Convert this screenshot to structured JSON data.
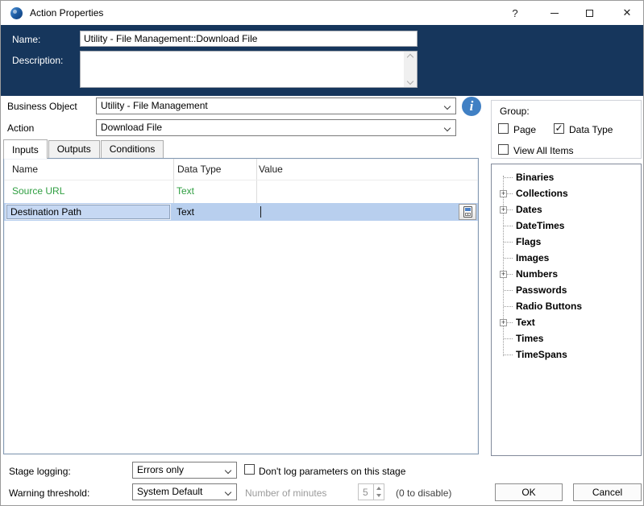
{
  "window": {
    "title": "Action Properties",
    "help_glyph": "?"
  },
  "colors": {
    "header_navy": "#16365c",
    "input_green": "#2f9e41",
    "selection_blue": "#b8cfee",
    "info_blue": "#4080c4"
  },
  "header": {
    "name_label": "Name:",
    "name_value": "Utility - File Management::Download File",
    "description_label": "Description:",
    "description_value": ""
  },
  "form": {
    "business_object_label": "Business Object",
    "business_object_value": "Utility - File Management",
    "action_label": "Action",
    "action_value": "Download File"
  },
  "tabs": [
    {
      "label": "Inputs",
      "active": true
    },
    {
      "label": "Outputs",
      "active": false
    },
    {
      "label": "Conditions",
      "active": false
    }
  ],
  "table": {
    "columns": [
      "Name",
      "Data Type",
      "Value"
    ],
    "rows": [
      {
        "name": "Source URL",
        "data_type": "Text",
        "value": "",
        "state": "input-green"
      },
      {
        "name": "Destination Path",
        "data_type": "Text",
        "value": "",
        "state": "selected-editing"
      }
    ]
  },
  "group_panel": {
    "title": "Group:",
    "checkboxes": [
      {
        "label": "Page",
        "checked": false,
        "glyph": ""
      },
      {
        "label": "Data Type",
        "checked": true,
        "glyph": "✓"
      },
      {
        "label": "View All Items",
        "checked": false,
        "glyph": ""
      }
    ]
  },
  "tree": {
    "items": [
      {
        "label": "Binaries",
        "expandable": false
      },
      {
        "label": "Collections",
        "expandable": true,
        "expander_glyph": "+"
      },
      {
        "label": "Dates",
        "expandable": true,
        "expander_glyph": "+"
      },
      {
        "label": "DateTimes",
        "expandable": false
      },
      {
        "label": "Flags",
        "expandable": false
      },
      {
        "label": "Images",
        "expandable": false
      },
      {
        "label": "Numbers",
        "expandable": true,
        "expander_glyph": "+"
      },
      {
        "label": "Passwords",
        "expandable": false
      },
      {
        "label": "Radio Buttons",
        "expandable": false
      },
      {
        "label": "Text",
        "expandable": true,
        "expander_glyph": "+"
      },
      {
        "label": "Times",
        "expandable": false
      },
      {
        "label": "TimeSpans",
        "expandable": false
      }
    ]
  },
  "footer": {
    "stage_logging_label": "Stage logging:",
    "stage_logging_value": "Errors only",
    "dont_log_label": "Don't log parameters on this stage",
    "dont_log_checked": false,
    "dont_log_glyph": "",
    "warning_threshold_label": "Warning threshold:",
    "warning_threshold_value": "System Default",
    "minutes_label": "Number of minutes",
    "minutes_value": "5",
    "disable_hint": "(0 to disable)",
    "ok_label": "OK",
    "cancel_label": "Cancel"
  }
}
